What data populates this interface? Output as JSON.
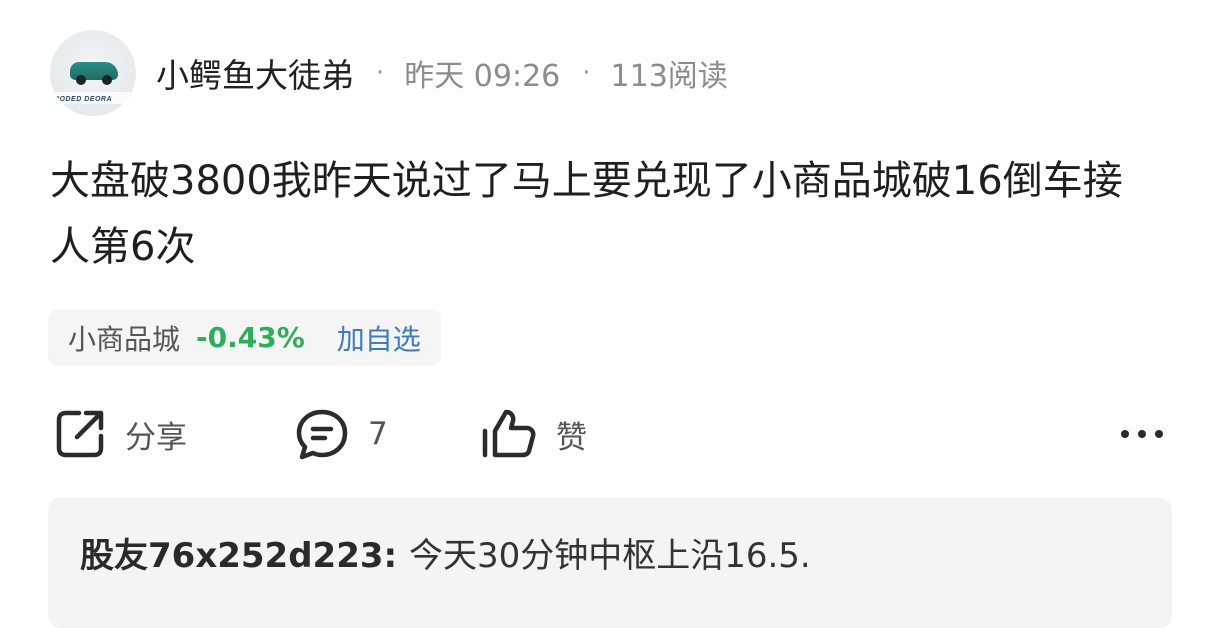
{
  "author": {
    "name": "小鳄鱼大徒弟",
    "avatar_icon": "car-avatar",
    "avatar_caption": "RODED DEORA"
  },
  "post": {
    "time": "昨天 09:26",
    "reads": "113阅读",
    "separator": "·",
    "text": "大盘破3800我昨天说过了马上要兑现了小商品城破16倒车接人第6次"
  },
  "stock": {
    "name": "小商品城",
    "change": "-0.43%",
    "add_label": "加自选",
    "change_color": "#2eae5a"
  },
  "actions": {
    "share_label": "分享",
    "comment_count": "7",
    "like_label": "赞",
    "share_icon": "share-icon",
    "comment_icon": "comment-icon",
    "like_icon": "thumbs-up-icon",
    "more_icon": "more-icon"
  },
  "top_comment": {
    "author": "股友76x252d223",
    "colon": ": ",
    "text": "今天30分钟中枢上沿16.5."
  }
}
